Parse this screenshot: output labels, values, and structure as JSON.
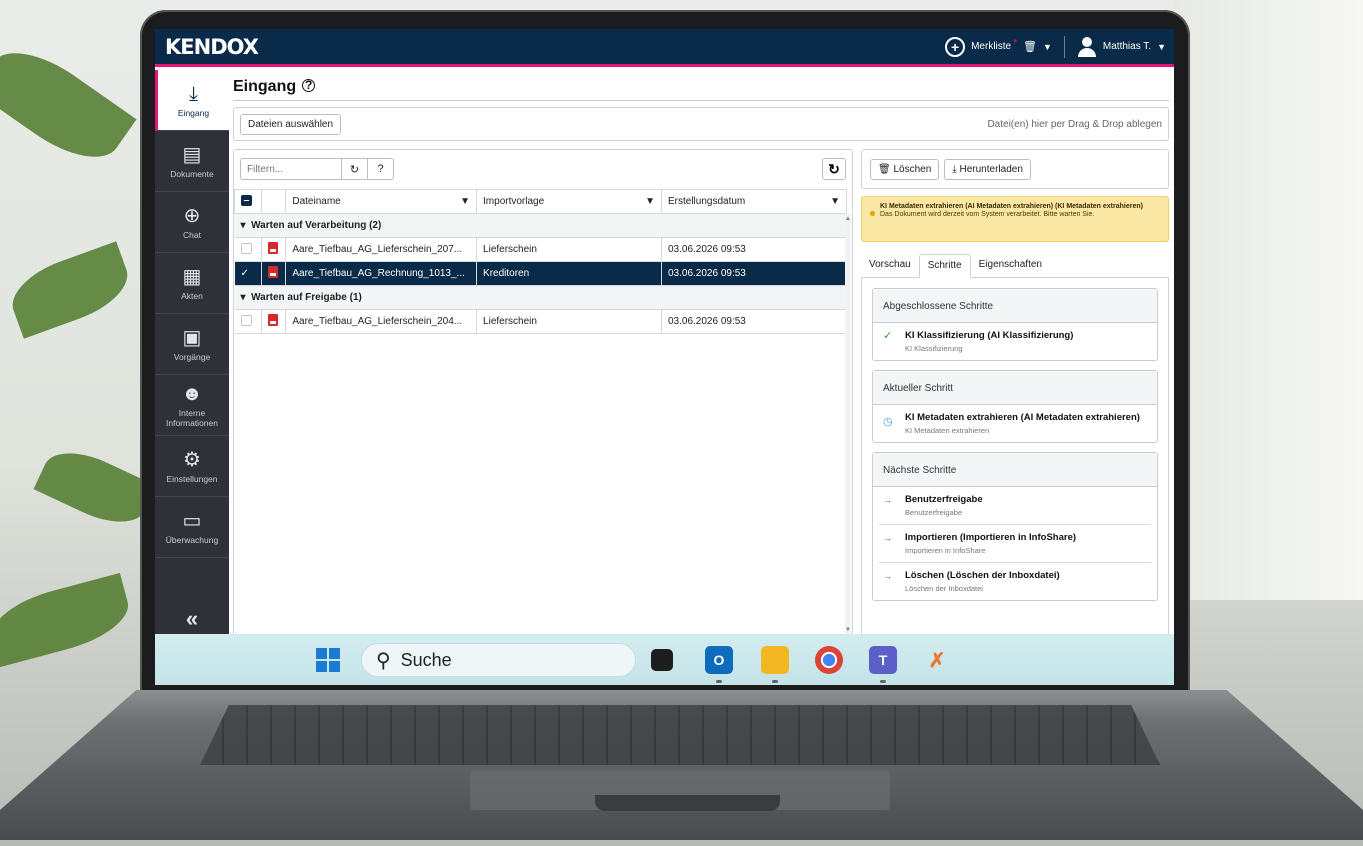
{
  "app": {
    "logo": "KENDOX",
    "topbar": {
      "merkliste": "Merkliste",
      "star": "*",
      "user": "Matthias T."
    }
  },
  "sidebar": {
    "items": [
      {
        "label": "Eingang",
        "icon": "download-icon",
        "active": true
      },
      {
        "label": "Dokumente",
        "icon": "document-icon"
      },
      {
        "label": "Chat",
        "icon": "globe-icon"
      },
      {
        "label": "Akten",
        "icon": "folder-print-icon"
      },
      {
        "label": "Vorgänge",
        "icon": "process-document-icon"
      },
      {
        "label": "Interne Informationen",
        "icon": "person-info-icon"
      },
      {
        "label": "Einstellungen",
        "icon": "gears-icon"
      },
      {
        "label": "Überwachung",
        "icon": "monitor-icon"
      }
    ],
    "collapse": "«"
  },
  "page": {
    "title": "Eingang",
    "select_files": "Dateien auswählen",
    "drop_hint": "Datei(en) hier per Drag & Drop ablegen"
  },
  "grid": {
    "filter_placeholder": "Filtern...",
    "columns": [
      "Dateiname",
      "Importvorlage",
      "Erstellungsdatum"
    ],
    "groups": [
      {
        "label": "Warten auf Verarbeitung (2)",
        "rows": [
          {
            "name": "Aare_Tiefbau_AG_Lieferschein_207...",
            "template": "Lieferschein",
            "date": "03.06.2026 09:53",
            "selected": false
          },
          {
            "name": "Aare_Tiefbau_AG_Rechnung_1013_...",
            "template": "Kreditoren",
            "date": "03.06.2026 09:53",
            "selected": true
          }
        ]
      },
      {
        "label": "Warten auf Freigabe (1)",
        "rows": [
          {
            "name": "Aare_Tiefbau_AG_Lieferschein_204...",
            "template": "Lieferschein",
            "date": "03.06.2026 09:53",
            "selected": false
          }
        ]
      }
    ]
  },
  "details": {
    "delete": "Löschen",
    "download": "Herunterladen",
    "warning_title": "KI Metadaten extrahieren (AI Metadaten extrahieren) (KI Metadaten extrahieren)",
    "warning_text": "Das Dokument wird derzeit vom System verarbeitet. Bitte warten Sie.",
    "tabs": [
      "Vorschau",
      "Schritte",
      "Eigenschaften"
    ],
    "active_tab": "Schritte",
    "completed": {
      "heading": "Abgeschlossene Schritte",
      "steps": [
        {
          "title": "KI Klassifizierung (AI Klassifizierung)",
          "sub": "KI Klassifizierung"
        }
      ]
    },
    "current": {
      "heading": "Aktueller Schritt",
      "steps": [
        {
          "title": "KI Metadaten extrahieren (AI Metadaten extrahieren)",
          "sub": "KI Metadaten extrahieren"
        }
      ]
    },
    "next": {
      "heading": "Nächste Schritte",
      "steps": [
        {
          "title": "Benutzerfreigabe",
          "sub": "Benutzerfreigabe"
        },
        {
          "title": "Importieren (Importieren in InfoShare)",
          "sub": "Importieren in InfoShare"
        },
        {
          "title": "Löschen (Löschen der Inboxdatei)",
          "sub": "Löschen der Inboxdatei"
        }
      ]
    }
  },
  "taskbar": {
    "search": "Suche"
  },
  "colors": {
    "brand_navy": "#0a2a4a",
    "accent_pink": "#e3147a",
    "warning_bg": "#fbe7a4"
  }
}
